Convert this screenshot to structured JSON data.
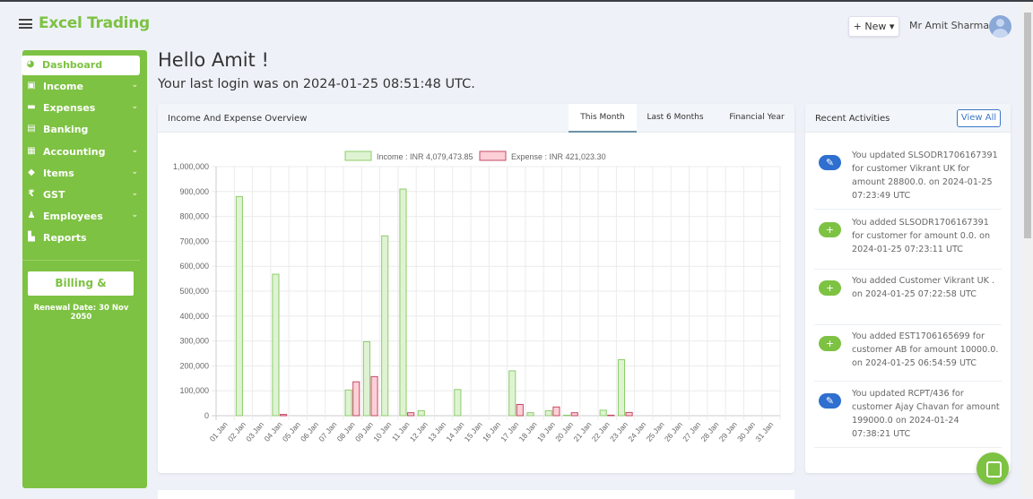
{
  "header": {
    "brand": "Excel Trading",
    "new_label": "+ New ▾",
    "user_name": "Mr Amit Sharma"
  },
  "sidebar": {
    "items": [
      {
        "label": "Dashboard",
        "icon": "◕",
        "chev": false
      },
      {
        "label": "Income",
        "icon": "▣",
        "chev": true
      },
      {
        "label": "Expenses",
        "icon": "▬",
        "chev": true
      },
      {
        "label": "Banking",
        "icon": "▤",
        "chev": false
      },
      {
        "label": "Accounting",
        "icon": "▦",
        "chev": true
      },
      {
        "label": "Items",
        "icon": "◆",
        "chev": true
      },
      {
        "label": "GST",
        "icon": "₹",
        "chev": true
      },
      {
        "label": "Employees",
        "icon": "♟",
        "chev": true
      },
      {
        "label": "Reports",
        "icon": "▙",
        "chev": false
      }
    ],
    "chevron": "⌄",
    "billing": "Billing & Upgrade",
    "renewal": "Renewal Date: 30 Nov 2050"
  },
  "main": {
    "greeting": "Hello Amit !",
    "last_login": "Your last login was on 2024-01-25 08:51:48 UTC."
  },
  "overview": {
    "title": "Income And Expense Overview",
    "tabs": [
      "This Month",
      "Last 6 Months",
      "Financial Year"
    ],
    "active_tab": "This Month"
  },
  "chart_data": {
    "type": "bar",
    "ylim": [
      0,
      1000000
    ],
    "yticks": [
      "0",
      "100,000",
      "200,000",
      "300,000",
      "400,000",
      "500,000",
      "600,000",
      "700,000",
      "800,000",
      "900,000",
      "1,000,000"
    ],
    "categories": [
      "01 Jan",
      "02 Jan",
      "03 Jan",
      "04 Jan",
      "05 Jan",
      "06 Jan",
      "07 Jan",
      "08 Jan",
      "09 Jan",
      "10 Jan",
      "11 Jan",
      "12 Jan",
      "13 Jan",
      "14 Jan",
      "15 Jan",
      "16 Jan",
      "17 Jan",
      "18 Jan",
      "19 Jan",
      "20 Jan",
      "21 Jan",
      "22 Jan",
      "23 Jan",
      "24 Jan",
      "25 Jan",
      "26 Jan",
      "27 Jan",
      "28 Jan",
      "29 Jan",
      "30 Jan",
      "31 Jan"
    ],
    "legend_position": "top",
    "series": [
      {
        "name": "Income : INR 4,079,473.85",
        "fill": "#dff3d3",
        "stroke": "#8ccc6c",
        "values": [
          0,
          880000,
          0,
          568000,
          0,
          0,
          0,
          103000,
          297000,
          722000,
          910000,
          20000,
          0,
          105000,
          0,
          0,
          180000,
          12000,
          20000,
          2000,
          0,
          22000,
          225000,
          0,
          0,
          0,
          0,
          0,
          0,
          0,
          0
        ]
      },
      {
        "name": "Expense : INR 421,023.30",
        "fill": "#fdd0d8",
        "stroke": "#c44a64",
        "values": [
          0,
          0,
          0,
          5000,
          0,
          0,
          0,
          136000,
          157000,
          0,
          12000,
          0,
          0,
          0,
          0,
          0,
          45000,
          0,
          35000,
          12000,
          0,
          2000,
          13000,
          0,
          0,
          0,
          0,
          0,
          0,
          0,
          0
        ]
      }
    ]
  },
  "recent": {
    "title": "Recent Activities",
    "view_all": "View All",
    "items": [
      {
        "type": "update",
        "icon": "✎",
        "text": "You updated SLSODR1706167391 for customer Vikrant UK for amount 28800.0. on 2024-01-25 07:23:49 UTC"
      },
      {
        "type": "add",
        "icon": "+",
        "text": "You added SLSODR1706167391 for customer for amount 0.0. on 2024-01-25 07:23:11 UTC"
      },
      {
        "type": "add",
        "icon": "+",
        "text": "You added Customer Vikrant UK . on 2024-01-25 07:22:58 UTC"
      },
      {
        "type": "add",
        "icon": "+",
        "text": "You added EST1706165699 for customer AB for amount 10000.0. on 2024-01-25 06:54:59 UTC"
      },
      {
        "type": "update",
        "icon": "✎",
        "text": "You updated RCPT/436 for customer Ajay Chavan for amount 199000.0 on 2024-01-24 07:38:21 UTC"
      }
    ]
  },
  "colors": {
    "brand": "#7dc242",
    "update": "#2f6fd0",
    "add": "#7dc242"
  }
}
